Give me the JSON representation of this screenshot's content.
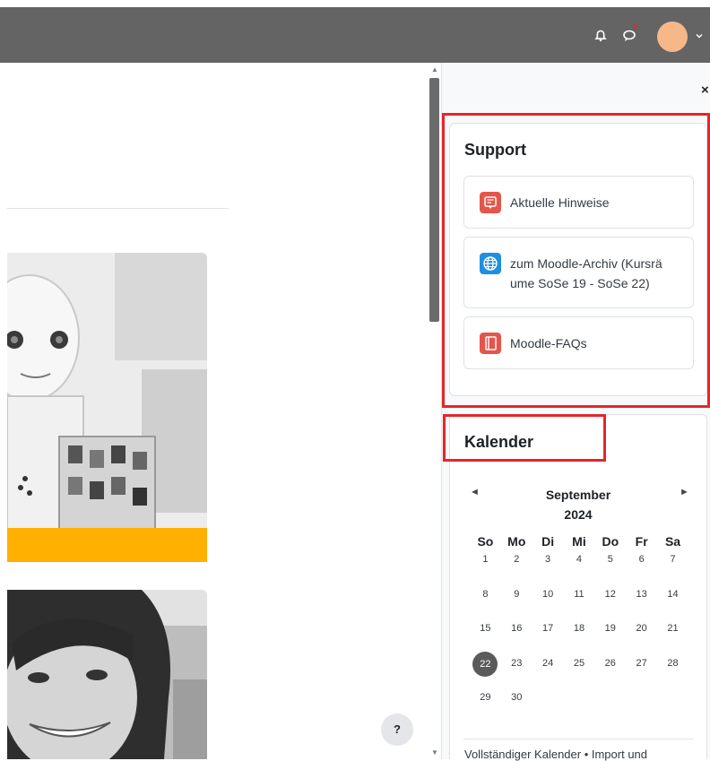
{
  "header": {
    "notification_badge": "1",
    "icons": [
      "bell-icon",
      "chat-icon",
      "user-avatar",
      "chevron-down-icon"
    ]
  },
  "help": {
    "label": "?"
  },
  "drawer": {
    "close_label": "×",
    "support": {
      "title": "Support",
      "links": [
        {
          "label": "Aktuelle Hinweise",
          "icon": "notice-icon",
          "color": "#e4554b"
        },
        {
          "label": "zum Moodle-Archiv (Kursrä ume SoSe 19 - SoSe 22)",
          "icon": "globe-icon",
          "color": "#1f8fe0"
        },
        {
          "label": "Moodle-FAQs",
          "icon": "book-icon",
          "color": "#e4554b"
        }
      ]
    },
    "calendar": {
      "title": "Kalender",
      "prev": "◄",
      "next": "►",
      "month": "September",
      "year": "2024",
      "weekdays": [
        "So",
        "Mo",
        "Di",
        "Mi",
        "Do",
        "Fr",
        "Sa"
      ],
      "weeks": [
        [
          "1",
          "2",
          "3",
          "4",
          "5",
          "6",
          "7"
        ],
        [
          "8",
          "9",
          "10",
          "11",
          "12",
          "13",
          "14"
        ],
        [
          "15",
          "16",
          "17",
          "18",
          "19",
          "20",
          "21"
        ],
        [
          "22",
          "23",
          "24",
          "25",
          "26",
          "27",
          "28"
        ],
        [
          "29",
          "30",
          "",
          "",
          "",
          "",
          ""
        ]
      ],
      "today": "22",
      "footer": "Vollständiger Kalender • Import und"
    }
  },
  "colors": {
    "header_bg": "#646464",
    "highlight_box": "#e5262b",
    "card_band": "#ffb000",
    "today_bg": "#5a5a5a"
  }
}
